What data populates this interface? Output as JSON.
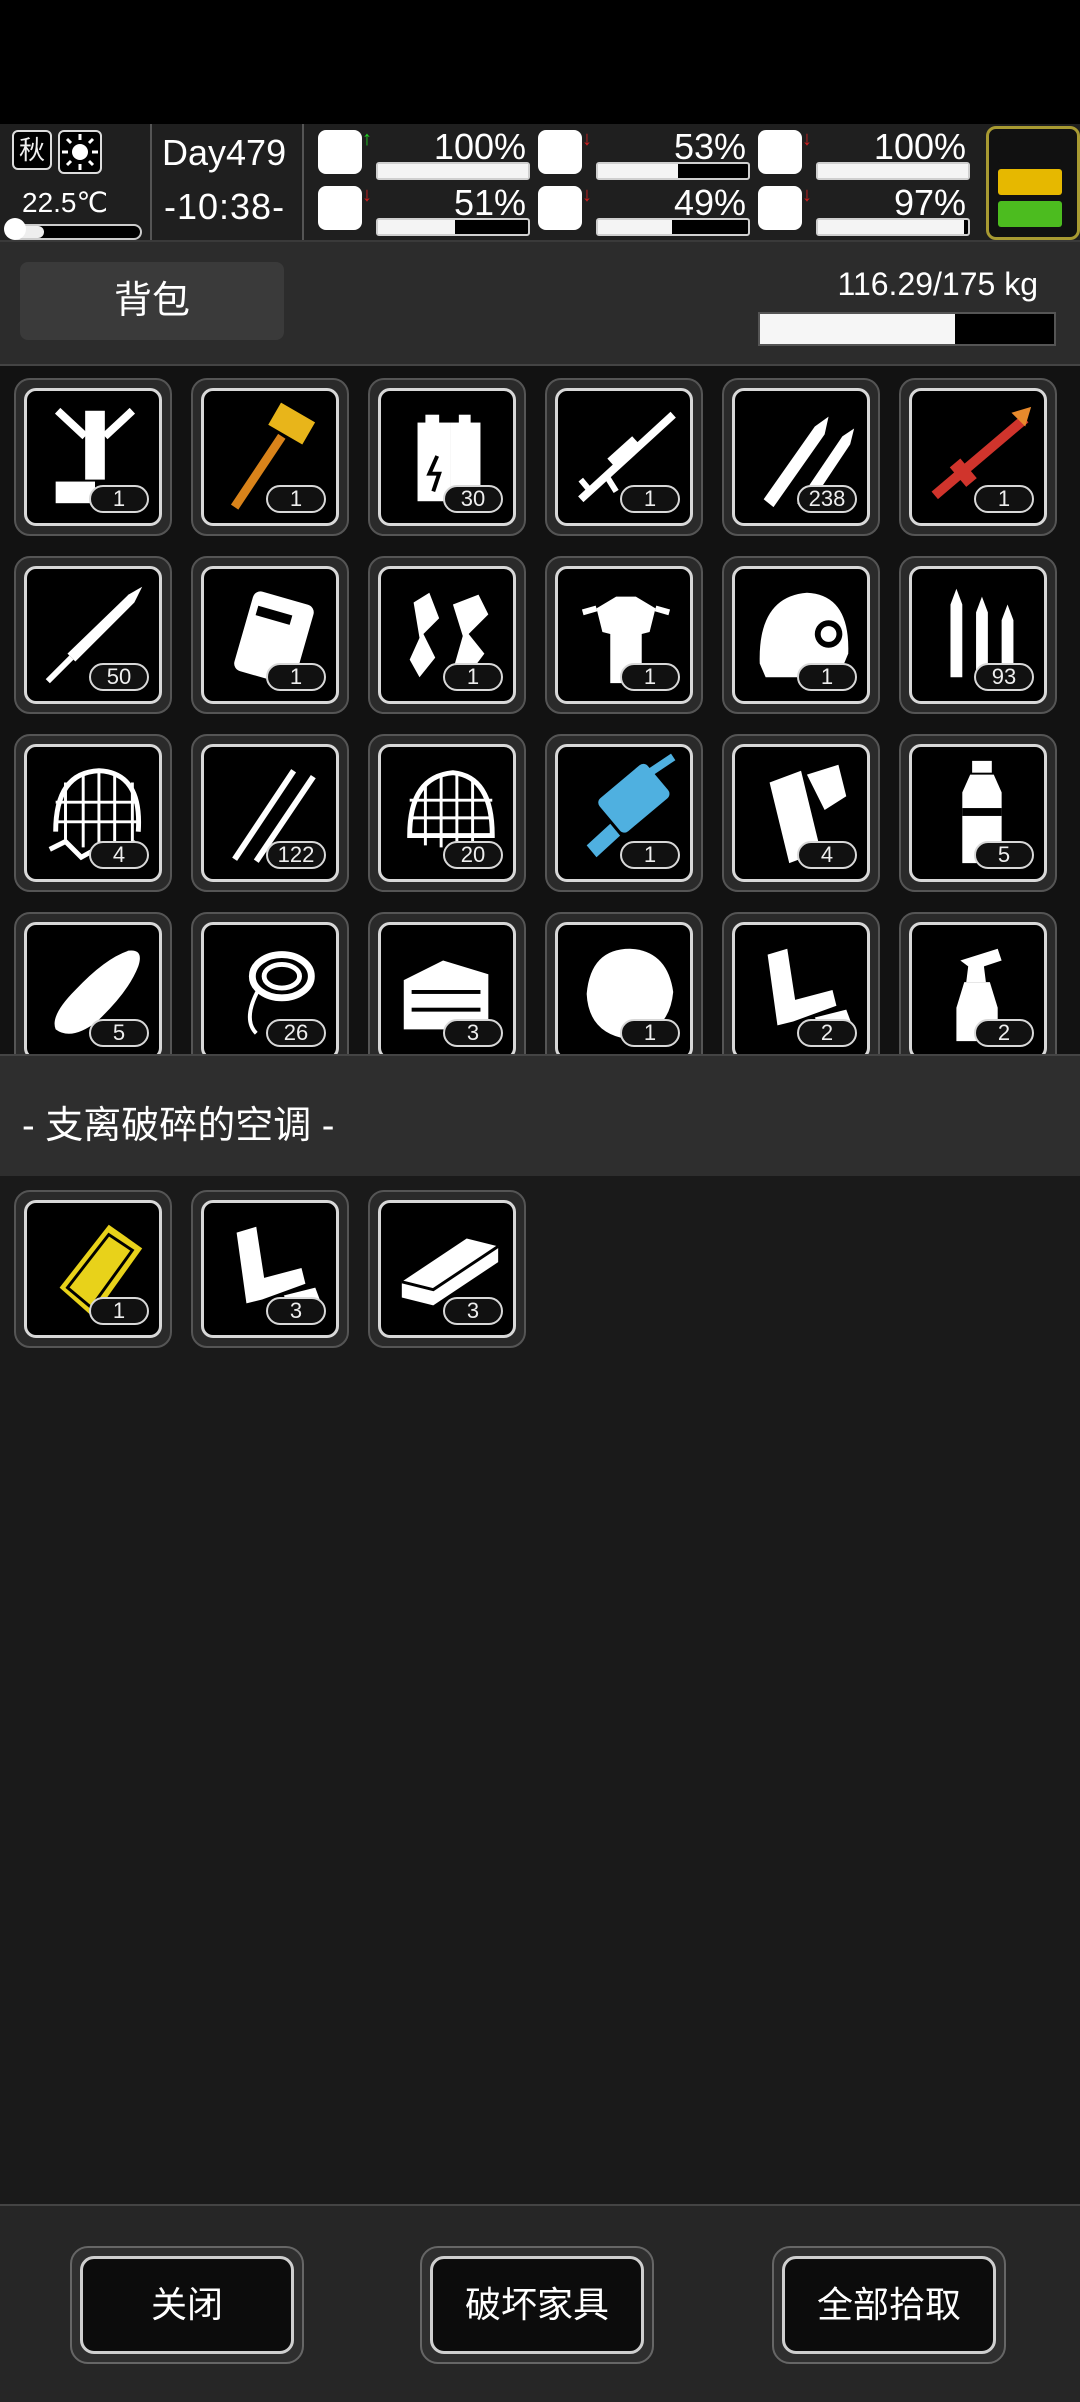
{
  "status": {
    "season": "秋",
    "temperature": "22.5℃",
    "day": "Day479",
    "time": "-10:38-",
    "stats": [
      {
        "name": "health",
        "icon": "medkit-icon",
        "arrow": "up",
        "value": "100%",
        "level": 1.0
      },
      {
        "name": "hunger",
        "icon": "stomach-icon",
        "arrow": "down",
        "value": "53%",
        "level": 0.53
      },
      {
        "name": "oxygen",
        "icon": "mask-icon",
        "arrow": "down",
        "value": "100%",
        "level": 1.0
      },
      {
        "name": "stamina",
        "icon": "boot-icon",
        "arrow": "down",
        "value": "51%",
        "level": 0.51
      },
      {
        "name": "thirst",
        "icon": "water-drop-icon",
        "arrow": "down",
        "value": "49%",
        "level": 0.49
      },
      {
        "name": "mood",
        "icon": "heart-icon",
        "arrow": "down",
        "value": "97%",
        "level": 0.97
      }
    ],
    "battery_colors": [
      "#111111",
      "#e6b800",
      "#4cbc1f"
    ]
  },
  "backpack": {
    "tab_label": "背包",
    "weight": "116.29/175 kg",
    "weight_fraction": 0.664,
    "items": [
      {
        "icon": "cart-parts-icon",
        "count": "1",
        "color": "#ffffff"
      },
      {
        "icon": "sledgehammer-icon",
        "count": "1",
        "color": "#e8b51a"
      },
      {
        "icon": "battery-icon",
        "count": "30",
        "color": "#ffffff"
      },
      {
        "icon": "sniper-rifle-icon",
        "count": "1",
        "color": "#ffffff"
      },
      {
        "icon": "bullets-icon",
        "count": "238",
        "color": "#ffffff"
      },
      {
        "icon": "rocket-launcher-icon",
        "count": "1",
        "color": "#d0342c"
      },
      {
        "icon": "rocket-icon",
        "count": "50",
        "color": "#ffffff"
      },
      {
        "icon": "armor-plate-icon",
        "count": "1",
        "color": "#ffffff"
      },
      {
        "icon": "scrap-metal-icon",
        "count": "1",
        "color": "#ffffff"
      },
      {
        "icon": "body-armor-icon",
        "count": "1",
        "color": "#ffffff"
      },
      {
        "icon": "helmet-icon",
        "count": "1",
        "color": "#ffffff"
      },
      {
        "icon": "ammo-icon",
        "count": "93",
        "color": "#ffffff"
      },
      {
        "icon": "net-trap-icon",
        "count": "4",
        "color": "#ffffff"
      },
      {
        "icon": "tweezers-icon",
        "count": "122",
        "color": "#ffffff"
      },
      {
        "icon": "net-icon",
        "count": "20",
        "color": "#ffffff"
      },
      {
        "icon": "minigun-icon",
        "count": "1",
        "color": "#4fb0e0"
      },
      {
        "icon": "paper-roll-icon",
        "count": "4",
        "color": "#ffffff"
      },
      {
        "icon": "water-bottle-icon",
        "count": "5",
        "color": "#ffffff"
      },
      {
        "icon": "bread-icon",
        "count": "5",
        "color": "#ffffff"
      },
      {
        "icon": "rope-icon",
        "count": "26",
        "color": "#ffffff"
      },
      {
        "icon": "toolbox-icon",
        "count": "3",
        "color": "#ffffff"
      },
      {
        "icon": "fur-icon",
        "count": "1",
        "color": "#ffffff"
      },
      {
        "icon": "pipe-parts-icon",
        "count": "2",
        "color": "#ffffff"
      },
      {
        "icon": "spray-bottle-icon",
        "count": "2",
        "color": "#ffffff"
      }
    ]
  },
  "loot": {
    "title": "- 支离破碎的空调 -",
    "items": [
      {
        "icon": "metal-plate-icon",
        "count": "1",
        "color": "#e8d21a"
      },
      {
        "icon": "pipe-parts-icon",
        "count": "3",
        "color": "#ffffff"
      },
      {
        "icon": "metal-bar-icon",
        "count": "3",
        "color": "#ffffff"
      }
    ]
  },
  "buttons": {
    "close": "关闭",
    "destroy": "破坏家具",
    "take_all": "全部拾取"
  }
}
